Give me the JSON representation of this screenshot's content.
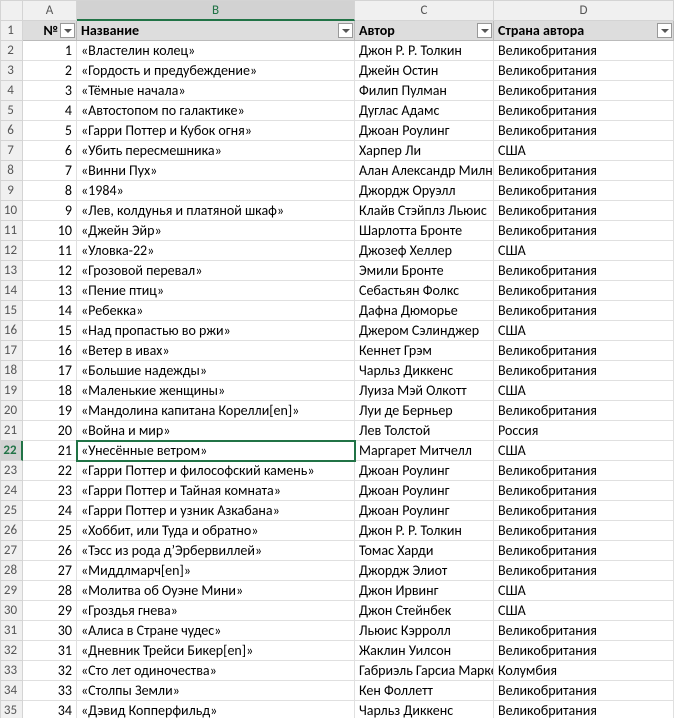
{
  "columnLetters": [
    "A",
    "B",
    "C",
    "D"
  ],
  "headerRow": [
    "№",
    "Название",
    "Автор",
    "Страна автора"
  ],
  "selected": {
    "row": 22,
    "col": "B",
    "rowIndex": 21
  },
  "rows": [
    {
      "n": 1,
      "title": "«Властелин колец»",
      "author": "Джон Р. Р. Толкин",
      "country": "Великобритания"
    },
    {
      "n": 2,
      "title": "«Гордость и предубеждение»",
      "author": "Джейн Остин",
      "country": "Великобритания"
    },
    {
      "n": 3,
      "title": "«Тёмные начала»",
      "author": "Филип Пулман",
      "country": "Великобритания"
    },
    {
      "n": 4,
      "title": "«Автостопом по галактике»",
      "author": "Дуглас Адамс",
      "country": "Великобритания"
    },
    {
      "n": 5,
      "title": "«Гарри Поттер и Кубок огня»",
      "author": "Джоан Роулинг",
      "country": "Великобритания"
    },
    {
      "n": 6,
      "title": "«Убить пересмешника»",
      "author": "Харпер Ли",
      "country": "США"
    },
    {
      "n": 7,
      "title": "«Винни Пух»",
      "author": "Алан Александр Милн",
      "country": "Великобритания"
    },
    {
      "n": 8,
      "title": "«1984»",
      "author": "Джордж Оруэлл",
      "country": "Великобритания"
    },
    {
      "n": 9,
      "title": "«Лев, колдунья и платяной шкаф»",
      "author": "Клайв Стэйплз Льюис",
      "country": "Великобритания"
    },
    {
      "n": 10,
      "title": "«Джейн Эйр»",
      "author": "Шарлотта Бронте",
      "country": "Великобритания"
    },
    {
      "n": 11,
      "title": "«Уловка-22»",
      "author": "Джозеф Хеллер",
      "country": "США"
    },
    {
      "n": 12,
      "title": "«Грозовой перевал»",
      "author": "Эмили Бронте",
      "country": "Великобритания"
    },
    {
      "n": 13,
      "title": "«Пение птиц»",
      "author": "Себастьян Фолкс",
      "country": "Великобритания"
    },
    {
      "n": 14,
      "title": "«Ребекка»",
      "author": "Дафна Дюморье",
      "country": "Великобритания"
    },
    {
      "n": 15,
      "title": "«Над пропастью во ржи»",
      "author": "Джером Сэлинджер",
      "country": "США"
    },
    {
      "n": 16,
      "title": "«Ветер в ивах»",
      "author": "Кеннет Грэм",
      "country": "Великобритания"
    },
    {
      "n": 17,
      "title": "«Большие надежды»",
      "author": "Чарльз Диккенс",
      "country": "Великобритания"
    },
    {
      "n": 18,
      "title": "«Маленькие женщины»",
      "author": "Луиза Мэй Олкотт",
      "country": "США"
    },
    {
      "n": 19,
      "title": "«Мандолина капитана Корелли[en]»",
      "author": "Луи де Берньер",
      "country": "Великобритания"
    },
    {
      "n": 20,
      "title": "«Война и мир»",
      "author": "Лев Толстой",
      "country": "Россия"
    },
    {
      "n": 21,
      "title": "«Унесённые ветром»",
      "author": "Маргарет Митчелл",
      "country": "США"
    },
    {
      "n": 22,
      "title": "«Гарри Поттер и философский камень»",
      "author": "Джоан Роулинг",
      "country": "Великобритания"
    },
    {
      "n": 23,
      "title": "«Гарри Поттер и Тайная комната»",
      "author": "Джоан Роулинг",
      "country": "Великобритания"
    },
    {
      "n": 24,
      "title": "«Гарри Поттер и узник Азкабана»",
      "author": "Джоан Роулинг",
      "country": "Великобритания"
    },
    {
      "n": 25,
      "title": "«Хоббит, или Туда и обратно»",
      "author": "Джон Р. Р. Толкин",
      "country": "Великобритания"
    },
    {
      "n": 26,
      "title": "«Тэсс из рода д’Эрбервиллей»",
      "author": "Томас Харди",
      "country": "Великобритания"
    },
    {
      "n": 27,
      "title": "«Миддлмарч[en]»",
      "author": "Джордж Элиот",
      "country": "Великобритания"
    },
    {
      "n": 28,
      "title": "«Молитва об Оуэне Мини»",
      "author": "Джон Ирвинг",
      "country": "США"
    },
    {
      "n": 29,
      "title": "«Гроздья гнева»",
      "author": "Джон Стейнбек",
      "country": "США"
    },
    {
      "n": 30,
      "title": "«Алиса в Стране чудес»",
      "author": "Льюис Кэрролл",
      "country": "Великобритания"
    },
    {
      "n": 31,
      "title": "«Дневник Трейси Бикер[en]»",
      "author": "Жаклин Уилсон",
      "country": "Великобритания"
    },
    {
      "n": 32,
      "title": "«Сто лет одиночества»",
      "author": "Габриэль Гарсиа Маркес",
      "country": "Колумбия"
    },
    {
      "n": 33,
      "title": "«Столпы Земли»",
      "author": "Кен Фоллетт",
      "country": "Великобритания"
    },
    {
      "n": 34,
      "title": "«Дэвид Копперфильд»",
      "author": "Чарльз Диккенс",
      "country": "Великобритания"
    }
  ]
}
